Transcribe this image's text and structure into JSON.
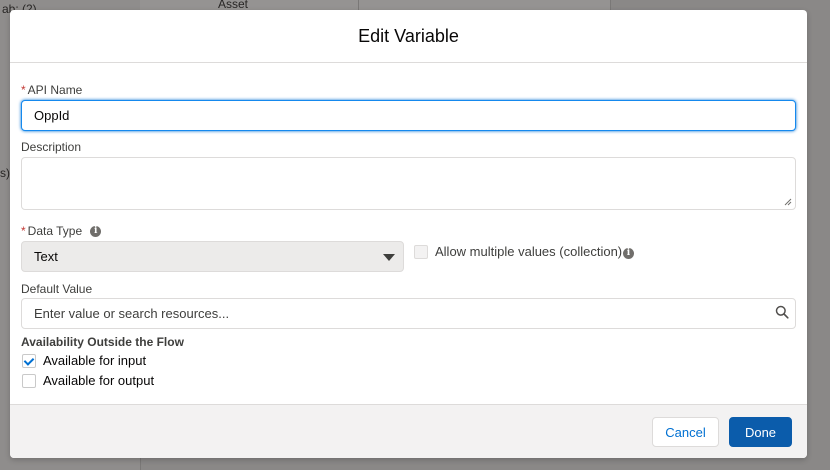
{
  "background": {
    "left_label": "ab: (2)",
    "top_label": "Asset",
    "side_paren": "s)"
  },
  "modal": {
    "title": "Edit Variable",
    "api_name": {
      "label": "API Name",
      "value": "OppId",
      "required": true
    },
    "description": {
      "label": "Description",
      "value": ""
    },
    "data_type": {
      "label": "Data Type",
      "selected": "Text",
      "required": true,
      "info_icon": "info-icon"
    },
    "allow_multiple": {
      "label": "Allow multiple values (collection)",
      "checked": false,
      "disabled": true,
      "info_icon": "info-icon"
    },
    "default_value": {
      "label": "Default Value",
      "placeholder": "Enter value or search resources...",
      "icon": "search-icon"
    },
    "availability": {
      "title": "Availability Outside the Flow",
      "input": {
        "label": "Available for input",
        "checked": true
      },
      "output": {
        "label": "Available for output",
        "checked": false
      }
    },
    "footer": {
      "cancel_label": "Cancel",
      "done_label": "Done"
    }
  },
  "colors": {
    "brand_button": "#0b5cab",
    "link": "#0070d2",
    "required": "#c23934",
    "focus_border": "#1589ee"
  }
}
